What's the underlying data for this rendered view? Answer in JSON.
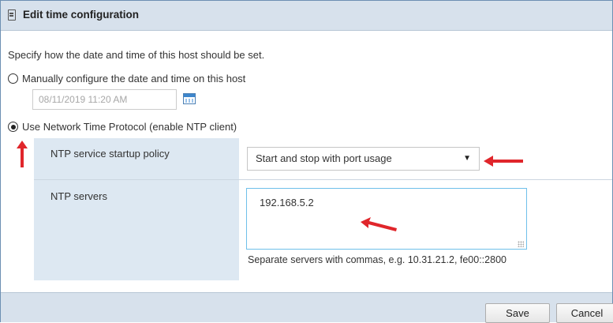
{
  "dialog": {
    "title": "Edit time configuration",
    "title_icon": "document-icon"
  },
  "intro": "Specify how the date and time of this host should be set.",
  "manual_option": {
    "label": "Manually configure the date and time on this host",
    "selected": false,
    "datetime_value": "08/11/2019 11:20 AM",
    "datetime_disabled": true,
    "calendar_icon": "calendar-icon"
  },
  "ntp_option": {
    "label": "Use Network Time Protocol (enable NTP client)",
    "selected": true
  },
  "ntp_settings": {
    "startup_policy_label": "NTP service startup policy",
    "startup_policy_value": "Start and stop with port usage",
    "servers_label": "NTP servers",
    "servers_value": "192.168.5.2",
    "servers_hint": "Separate servers with commas, e.g. 10.31.21.2, fe00::2800"
  },
  "buttons": {
    "save_label": "Save",
    "cancel_label": "Cancel"
  },
  "colors": {
    "titlebar": "#d7e1ec",
    "panel": "#dde8f2",
    "annotation_arrow": "#e0262b",
    "textarea_focus": "#6fc0ea"
  }
}
